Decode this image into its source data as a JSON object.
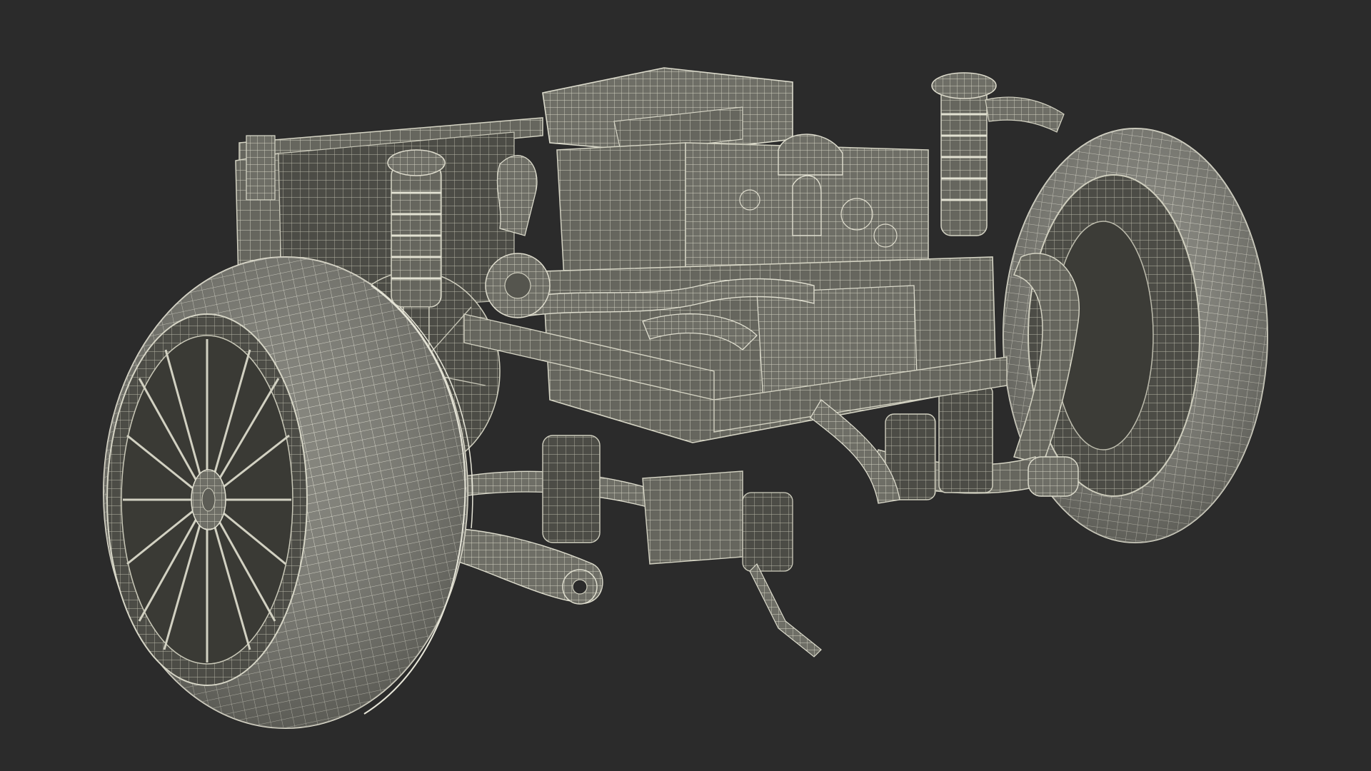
{
  "scene": {
    "background_color": "#2b2b2b",
    "mesh_color": "#c9c8b8",
    "surface_color": "#6b6b63",
    "shadow_color": "#3a3a36",
    "highlight_color": "#e6e5d8"
  }
}
